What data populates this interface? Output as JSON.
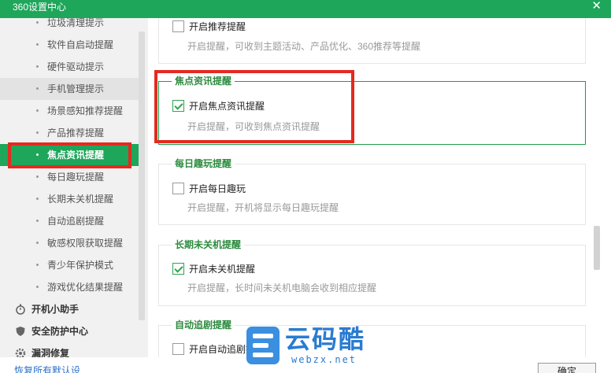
{
  "window": {
    "title": "360设置中心",
    "close_glyph": "✕"
  },
  "sidebar": {
    "sub_items": [
      {
        "label": "垃圾清理提示"
      },
      {
        "label": "软件自启动提醒"
      },
      {
        "label": "硬件驱动提示"
      },
      {
        "label": "手机管理提示"
      },
      {
        "label": "场景感知推荐提醒"
      },
      {
        "label": "产品推荐提醒"
      },
      {
        "label": "焦点资讯提醒"
      },
      {
        "label": "每日趣玩提醒"
      },
      {
        "label": "长期未关机提醒"
      },
      {
        "label": "自动追剧提醒"
      },
      {
        "label": "敏感权限获取提醒"
      },
      {
        "label": "青少年保护模式"
      },
      {
        "label": "游戏优化结果提醒"
      }
    ],
    "groups": [
      {
        "label": "开机小助手",
        "icon": "stopwatch-icon"
      },
      {
        "label": "安全防护中心",
        "icon": "shield-icon"
      },
      {
        "label": "漏洞修复",
        "icon": "gear-icon"
      }
    ]
  },
  "content": {
    "recommend": {
      "checkbox_label": "开启推荐提醒",
      "checked": false,
      "desc": "开启提醒，可收到主题活动、产品优化、360推荐等提醒"
    },
    "focus_news": {
      "title": "焦点资讯提醒",
      "checkbox_label": "开启焦点资讯提醒",
      "checked": true,
      "desc": "开启提醒，可收到焦点资讯提醒"
    },
    "daily_fun": {
      "title": "每日趣玩提醒",
      "checkbox_label": "开启每日趣玩",
      "checked": false,
      "desc": "开启提醒，开机将显示每日趣玩提醒"
    },
    "long_uptime": {
      "title": "长期未关机提醒",
      "checkbox_label": "开启未关机提醒",
      "checked": true,
      "desc": "开启提醒，长时间未关机电脑会收到相应提醒"
    },
    "auto_drama": {
      "title": "自动追剧提醒",
      "checkbox_label": "开启自动追剧提醒",
      "checked": false
    }
  },
  "watermark": {
    "main": "云码酷",
    "sub": "webzx.net"
  },
  "footer": {
    "restore_link": "恢复所有默认设",
    "ok_label": "确定"
  },
  "colors": {
    "brand_green": "#1ea65a",
    "highlight_red": "#e42a20",
    "section_title_green": "#2c8a3e"
  }
}
